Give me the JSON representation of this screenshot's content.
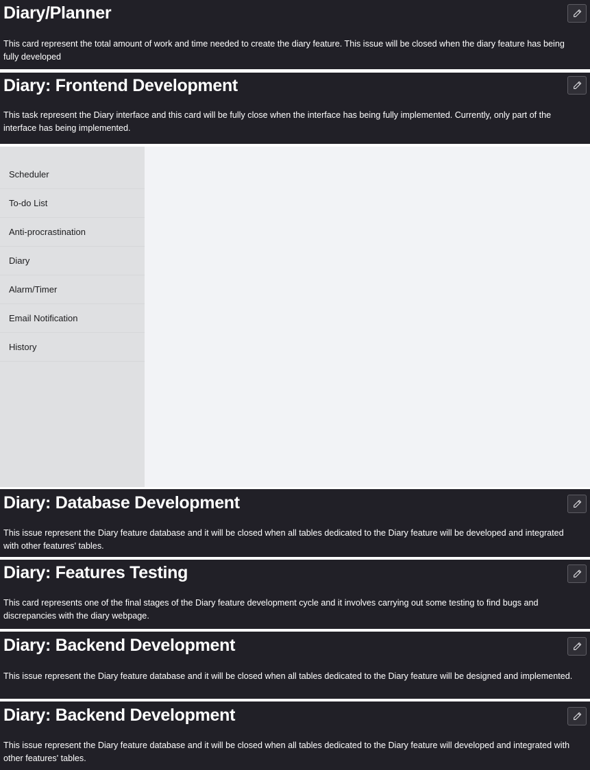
{
  "cards": [
    {
      "title": "Diary/Planner",
      "description": "This card represent the total amount of work and time needed to create the diary feature. This issue will be closed when the diary feature has being fully developed"
    },
    {
      "title": "Diary: Frontend Development",
      "description": "This task represent the Diary interface and this card will be fully close when the interface has being fully implemented. Currently, only part of the interface has being implemented."
    },
    {
      "title": "Diary: Database Development",
      "description": "This issue represent the Diary feature database and it will be closed when all tables dedicated to the Diary feature will be developed and integrated with other features' tables."
    },
    {
      "title": "Diary: Features Testing",
      "description": "This card represents one of the final stages of the Diary feature development cycle and it involves carrying out some testing to find bugs and discrepancies with the diary webpage."
    },
    {
      "title": "Diary: Backend Development",
      "description": "This issue represent the Diary feature database and it will be closed when all tables dedicated to the Diary feature will be designed and implemented."
    },
    {
      "title": "Diary: Backend Development",
      "description": "This issue represent the Diary feature database and it will be closed when all tables dedicated to the Diary feature will developed and integrated with other features' tables."
    }
  ],
  "edit_button": {
    "icon": "pencil-icon"
  },
  "sidebar": {
    "items": [
      {
        "label": "Scheduler"
      },
      {
        "label": "To-do List"
      },
      {
        "label": "Anti-procrastination"
      },
      {
        "label": "Diary"
      },
      {
        "label": "Alarm/Timer"
      },
      {
        "label": "Email Notification"
      },
      {
        "label": "History"
      }
    ]
  },
  "colors": {
    "card_background": "#212027",
    "card_text": "#ffffff",
    "sidebar_background": "#dfe0e2",
    "content_background": "#f2f3f6"
  }
}
